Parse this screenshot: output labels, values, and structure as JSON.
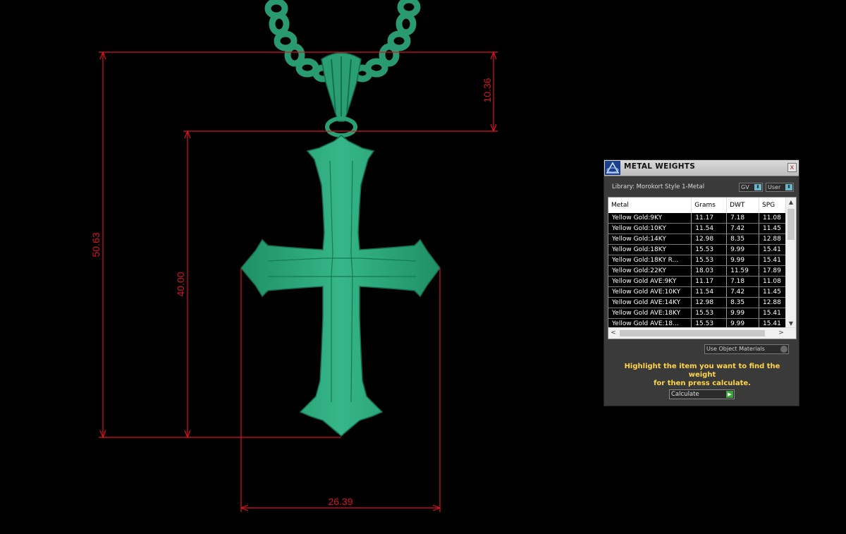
{
  "dimensions": {
    "total_height": "50.63",
    "body_height": "40.00",
    "bail_height": "10.36",
    "width": "26.39"
  },
  "colors": {
    "background": "#000000",
    "model": "#2fa87c",
    "dimension_lines": "#d8141f",
    "hint_text": "#ffd54a"
  },
  "panel": {
    "title": "METAL WEIGHTS",
    "close_label": "x",
    "library_label": "Library: Morokort Style 1-Metal",
    "gv_select": "GV",
    "user_select": "User",
    "columns": [
      "Metal",
      "Grams",
      "DWT",
      "SPG"
    ],
    "rows": [
      [
        "Yellow Gold:9KY",
        "11.17",
        "7.18",
        "11.08"
      ],
      [
        "Yellow Gold:10KY",
        "11.54",
        "7.42",
        "11.45"
      ],
      [
        "Yellow Gold:14KY",
        "12.98",
        "8.35",
        "12.88"
      ],
      [
        "Yellow Gold:18KY",
        "15.53",
        "9.99",
        "15.41"
      ],
      [
        "Yellow Gold:18KY R...",
        "15.53",
        "9.99",
        "15.41"
      ],
      [
        "Yellow Gold:22KY",
        "18.03",
        "11.59",
        "17.89"
      ],
      [
        "Yellow Gold AVE:9KY",
        "11.17",
        "7.18",
        "11.08"
      ],
      [
        "Yellow Gold AVE:10KY",
        "11.54",
        "7.42",
        "11.45"
      ],
      [
        "Yellow Gold AVE:14KY",
        "12.98",
        "8.35",
        "12.88"
      ],
      [
        "Yellow Gold AVE:18KY",
        "15.53",
        "9.99",
        "15.41"
      ],
      [
        "Yellow Gold AVE:18...",
        "15.53",
        "9.99",
        "15.41"
      ]
    ],
    "use_materials": "Use Object Materials",
    "hint_line1": "Highlight the item you want to find the weight",
    "hint_line2": "for then press calculate.",
    "calculate_label": "Calculate"
  }
}
